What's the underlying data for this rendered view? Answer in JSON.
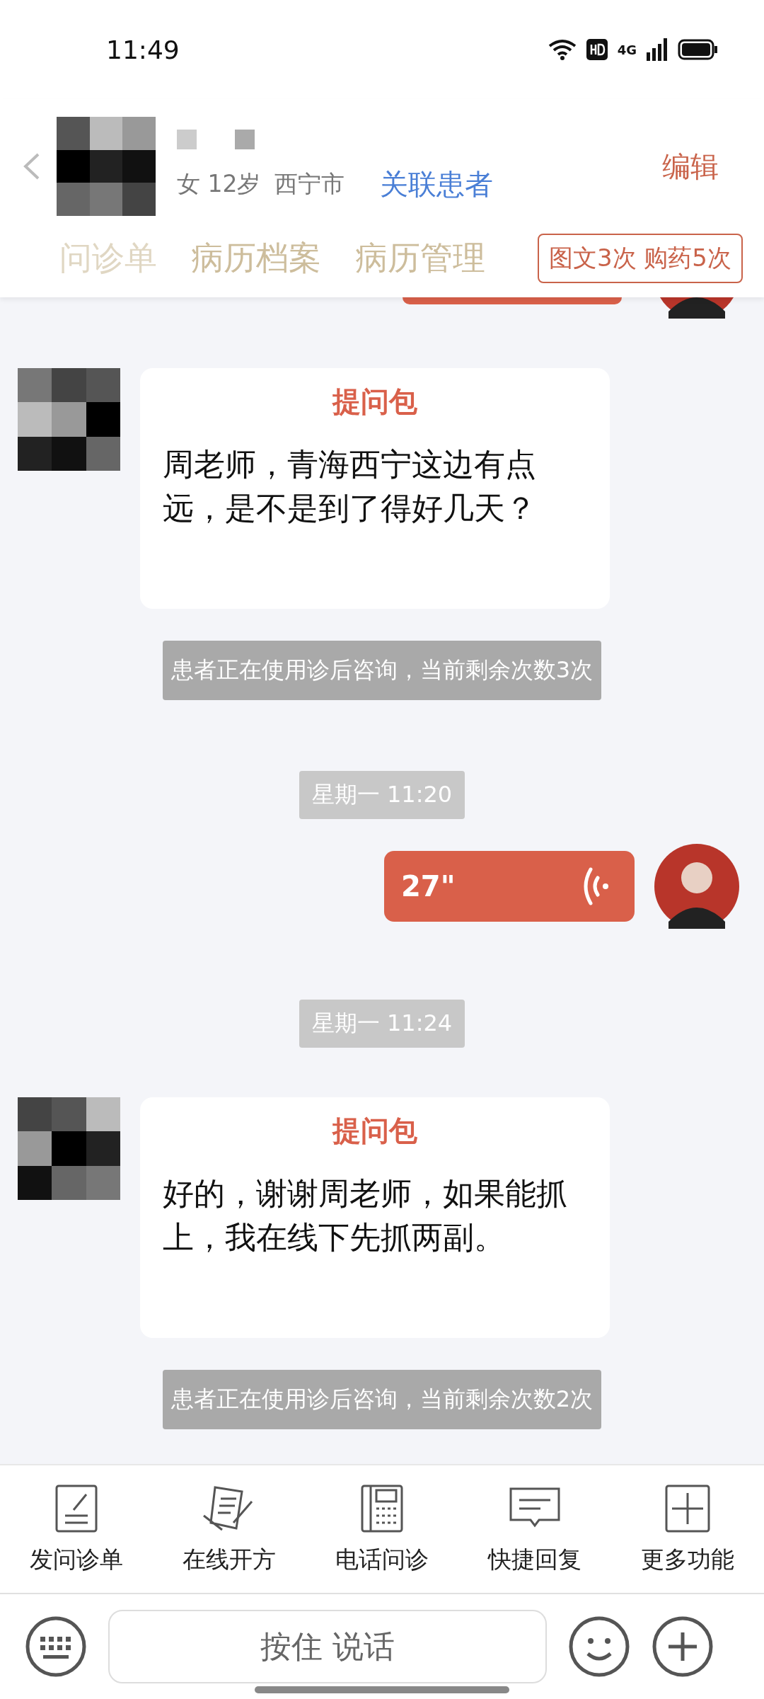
{
  "status_bar": {
    "time": "11:49",
    "network": "4G"
  },
  "header": {
    "gender_age": "女 12岁",
    "city": "西宁市",
    "link": "关联患者",
    "edit": "编辑",
    "quota": "图文3次 购药5次",
    "tabs": [
      {
        "label": "问诊单",
        "selected": false
      },
      {
        "label": "病历档案",
        "selected": false
      },
      {
        "label": "病历管理",
        "selected": false
      }
    ]
  },
  "messages": [
    {
      "kind": "voice_partial"
    },
    {
      "kind": "question",
      "title": "提问包",
      "text": "周老师，青海西宁这边有点远，是不是到了得好几天？"
    },
    {
      "kind": "notice",
      "text": "患者正在使用诊后咨询，当前剩余次数3次"
    },
    {
      "kind": "time",
      "text": "星期一 11:20"
    },
    {
      "kind": "voice",
      "duration": "27\""
    },
    {
      "kind": "time",
      "text": "星期一 11:24"
    },
    {
      "kind": "question",
      "title": "提问包",
      "text": "好的，谢谢周老师，如果能抓上，我在线下先抓两副。"
    },
    {
      "kind": "notice",
      "text": "患者正在使用诊后咨询，当前剩余次数2次"
    }
  ],
  "toolbar": [
    {
      "kind": "form",
      "label": "发问诊单"
    },
    {
      "kind": "prescription",
      "label": "在线开方"
    },
    {
      "kind": "phone",
      "label": "电话问诊"
    },
    {
      "kind": "reply",
      "label": "快捷回复"
    },
    {
      "kind": "more",
      "label": "更多功能"
    }
  ],
  "input_bar": {
    "talk_button": "按住 说话"
  }
}
